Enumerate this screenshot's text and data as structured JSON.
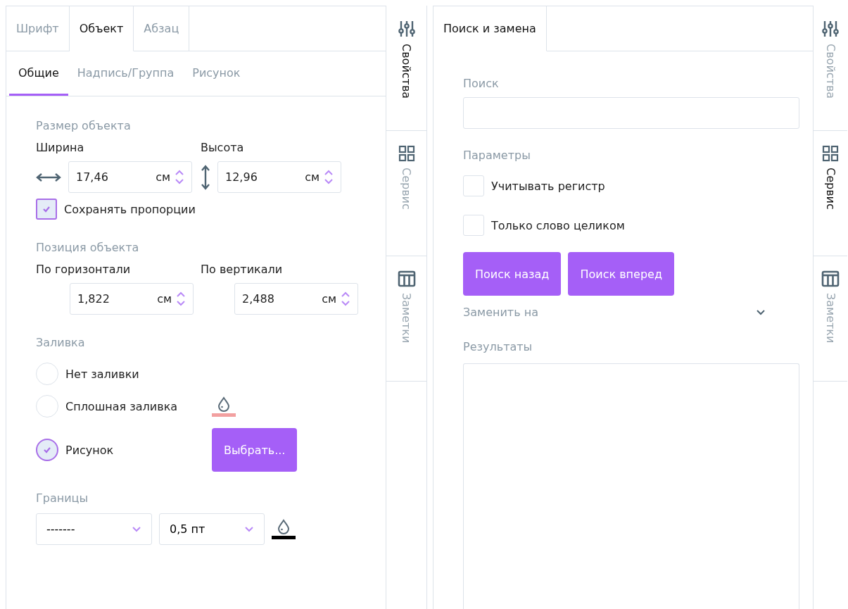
{
  "left_panel": {
    "tabs": [
      {
        "label": "Шрифт",
        "selected": false
      },
      {
        "label": "Объект",
        "selected": true
      },
      {
        "label": "Абзац",
        "selected": false
      }
    ],
    "subtabs": [
      {
        "label": "Общие",
        "selected": true
      },
      {
        "label": "Надпись/Группа",
        "selected": false
      },
      {
        "label": "Рисунок",
        "selected": false
      }
    ],
    "size": {
      "title": "Размер объекта",
      "fields": [
        {
          "label": "Ширина",
          "kind": "horizontal",
          "value": "17,46",
          "unit": "см"
        },
        {
          "label": "Высота",
          "kind": "vertical",
          "value": "12,96",
          "unit": "см"
        }
      ],
      "keep_ratio": {
        "label": "Сохранять пропорции",
        "checked": true
      }
    },
    "position": {
      "title": "Позиция объекта",
      "fields": [
        {
          "label": "По горизонтали",
          "value": "1,822",
          "unit": "см"
        },
        {
          "label": "По вертикали",
          "value": "2,488",
          "unit": "см"
        }
      ]
    },
    "fill": {
      "title": "Заливка",
      "options": [
        {
          "label": "Нет заливки",
          "selected": false,
          "kind": "none"
        },
        {
          "label": "Сплошная заливка",
          "selected": false,
          "kind": "color",
          "color": "#f2a0a0"
        },
        {
          "label": "Рисунок",
          "selected": true,
          "kind": "button",
          "button": "Выбрать..."
        }
      ]
    },
    "borders": {
      "title": "Границы",
      "style": "-------",
      "width": "0,5 пт",
      "color": "#000000"
    }
  },
  "left_rail": [
    {
      "label": "Свойства",
      "kind": "sliders",
      "selected": true
    },
    {
      "label": "Сервис",
      "kind": "grid",
      "selected": false
    },
    {
      "label": "Заметки",
      "kind": "columns",
      "selected": false
    }
  ],
  "right_panel": {
    "tabs": [
      {
        "label": "Поиск и замена",
        "selected": true
      }
    ],
    "search_label": "Поиск",
    "params_title": "Параметры",
    "options": [
      {
        "label": "Учитывать регистр",
        "checked": false
      },
      {
        "label": "Только слово целиком",
        "checked": false
      }
    ],
    "buttons": [
      "Поиск назад",
      "Поиск вперед"
    ],
    "replace": {
      "label": "Заменить на",
      "expanded": false
    },
    "results_label": "Результаты"
  },
  "right_rail": [
    {
      "label": "Свойства",
      "kind": "sliders",
      "selected": false
    },
    {
      "label": "Сервис",
      "kind": "grid",
      "selected": true
    },
    {
      "label": "Заметки",
      "kind": "columns",
      "selected": false
    }
  ]
}
